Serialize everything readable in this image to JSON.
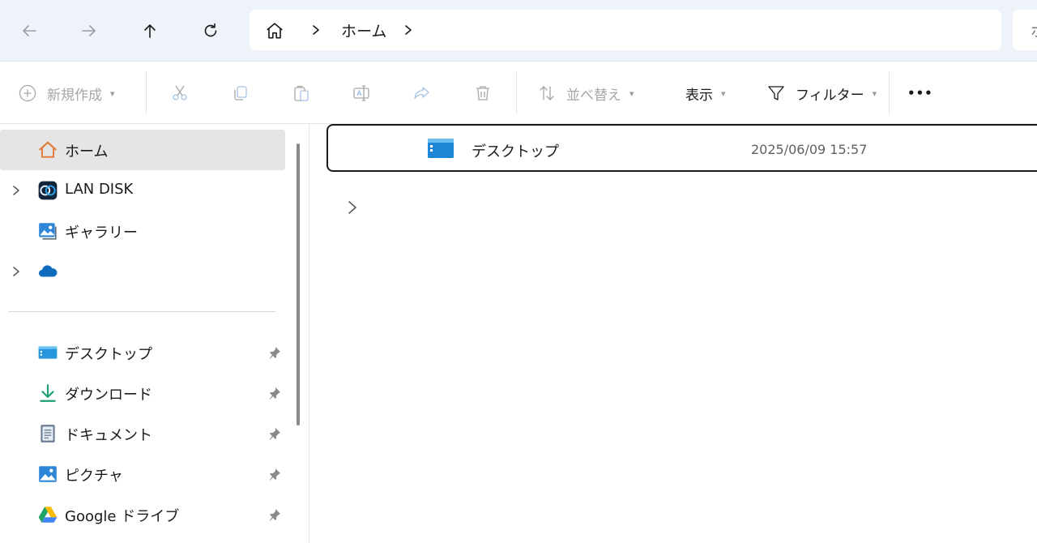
{
  "address_bar": {
    "breadcrumb": "ホーム",
    "search_placeholder_partial": "ホ"
  },
  "nav": {
    "icons": [
      "back-arrow-icon",
      "forward-arrow-icon",
      "up-arrow-icon",
      "refresh-icon"
    ]
  },
  "command_bar": {
    "new_label": "新規作成",
    "sort_label": "並べ替え",
    "view_label": "表示",
    "filter_label": "フィルター",
    "more_label": "•••"
  },
  "sidebar": {
    "items": [
      {
        "label": "ホーム",
        "icon": "home-icon"
      },
      {
        "label": "LAN DISK",
        "icon": "lan-disk-icon"
      },
      {
        "label": "ギャラリー",
        "icon": "gallery-icon"
      },
      {
        "label": "",
        "icon": "onedrive-cloud-icon"
      }
    ],
    "pinned": [
      {
        "label": "デスクトップ",
        "icon": "desktop-icon"
      },
      {
        "label": "ダウンロード",
        "icon": "download-icon"
      },
      {
        "label": "ドキュメント",
        "icon": "document-icon"
      },
      {
        "label": "ピクチャ",
        "icon": "pictures-icon"
      },
      {
        "label": "Google ドライブ",
        "icon": "google-drive-icon"
      }
    ]
  },
  "content": {
    "files": [
      {
        "name": "デスクトップ",
        "date": "2025/06/09 15:57",
        "icon": "desktop-folder-icon"
      }
    ]
  },
  "colors": {
    "addr_bg": "#eef3fa",
    "selected_bg": "#e5e5e5",
    "folder_blue": "#1e88d6",
    "home_orange": "#e07b39"
  }
}
